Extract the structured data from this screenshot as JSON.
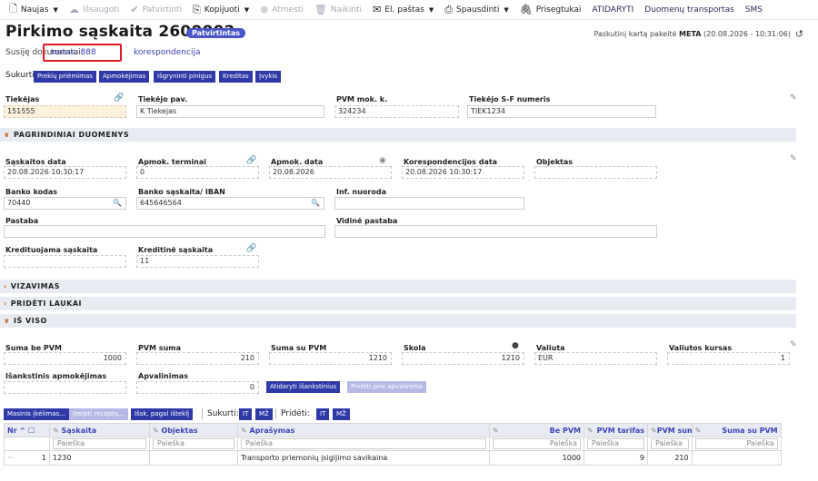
{
  "toolbar": {
    "new": "Naujas",
    "save": "Išsaugoti",
    "confirm": "Patvirtinti",
    "copy": "Kopijuoti",
    "reject": "Atmesti",
    "delete": "Naikinti",
    "email": "El. paštas",
    "print": "Spausdinti",
    "attachments": "Prisegtukai",
    "reopen": "ATIDARYTI",
    "transport": "Duomenų transportas",
    "sms": "SMS"
  },
  "header": {
    "title": "Pirkimo sąskaita 2600002",
    "status": "Patvirtintas",
    "last_edit_prefix": "Paskutinį kartą pakeitė",
    "last_edit_user": "META",
    "last_edit_time": "(20.08.2026 - 10:31:06)",
    "related_label": "Susiję dokumentai:",
    "related_asset": "turtas: 888",
    "related_corr": "korespondencija"
  },
  "create": {
    "label": "Sukurti:",
    "buttons": [
      "Prekių priėmimas",
      "Apmokėjimas",
      "Išgryninti pinigus",
      "Kreditas",
      "Įvykis"
    ]
  },
  "supplier": {
    "code_label": "Tiekėjas",
    "code": "151555",
    "name_label": "Tiekėjo pav.",
    "name": "K Tiekejas",
    "vat_label": "PVM mok. k.",
    "vat": "324234",
    "invoice_label": "Tiekėjo S-F numeris",
    "invoice": "TIEK1234"
  },
  "sections": {
    "main": "PAGRINDINIAI DUOMENYS",
    "approval": "VIZAVIMAS",
    "extra": "PRIDĖTI LAUKAI",
    "totals": "IŠ VISO"
  },
  "main": {
    "inv_date_label": "Sąskaitos data",
    "inv_date": "20.08.2026 10:30:17",
    "term_label": "Apmok. terminai",
    "term": "0",
    "pay_date_label": "Apmok. data",
    "pay_date": "20.08.2026",
    "corr_date_label": "Korespondencijos data",
    "corr_date": "20.08.2026 10:30:17",
    "object_label": "Objektas",
    "object": "",
    "bank_code_label": "Banko kodas",
    "bank_code": "70440",
    "iban_label": "Banko sąskaita/ IBAN",
    "iban": "645646564",
    "ref_label": "Inf. nuoroda",
    "ref": "",
    "note_label": "Pastaba",
    "note": "",
    "internal_note_label": "Vidinė pastaba",
    "internal_note": "",
    "credit_acc_label": "Kredituojama sąskaita",
    "credit_acc": "",
    "credit_inv_label": "Kreditinė sąskaita",
    "credit_inv": "11"
  },
  "totals": {
    "net_label": "Suma be PVM",
    "net": "1000",
    "vat_label": "PVM suma",
    "vat": "210",
    "gross_label": "Suma su PVM",
    "gross": "1210",
    "debt_label": "Skola",
    "debt": "1210",
    "currency_label": "Valiuta",
    "currency": "EUR",
    "rate_label": "Valiutos kursas",
    "rate": "1",
    "advance_label": "Išankstinis apmokėjimas",
    "advance": "",
    "rounding_label": "Apvalinimas",
    "rounding": "0",
    "open_advance_btn": "Atidaryti išankstinius",
    "add_rounding_btn": "Pridėti prie apvalinimo"
  },
  "grid_toolbar": {
    "mass_import": "Masinis įkėlimas...",
    "insert_recipe": "Įterpti receptą...",
    "expand": "Išsk. pagal išteklį",
    "create_label": "Sukurti:",
    "it": "IT",
    "mz": "MŽ",
    "add_label": "Pridėti:",
    "it2": "IT",
    "mz2": "MŽ"
  },
  "grid": {
    "columns": [
      "Nr",
      "Sąskaita",
      "Objektas",
      "Aprašymas",
      "Be PVM",
      "PVM tarifas",
      "PVM sum",
      "Suma su PVM"
    ],
    "search_placeholder": "Paieška",
    "rows": [
      {
        "menu": "···",
        "nr": "1",
        "account": "1230",
        "object": "",
        "description": "Transporto priemonių įsigijimo savikaina",
        "net": "1000",
        "vat_rate": "9",
        "vat_sum": "210",
        "gross": ""
      }
    ]
  }
}
